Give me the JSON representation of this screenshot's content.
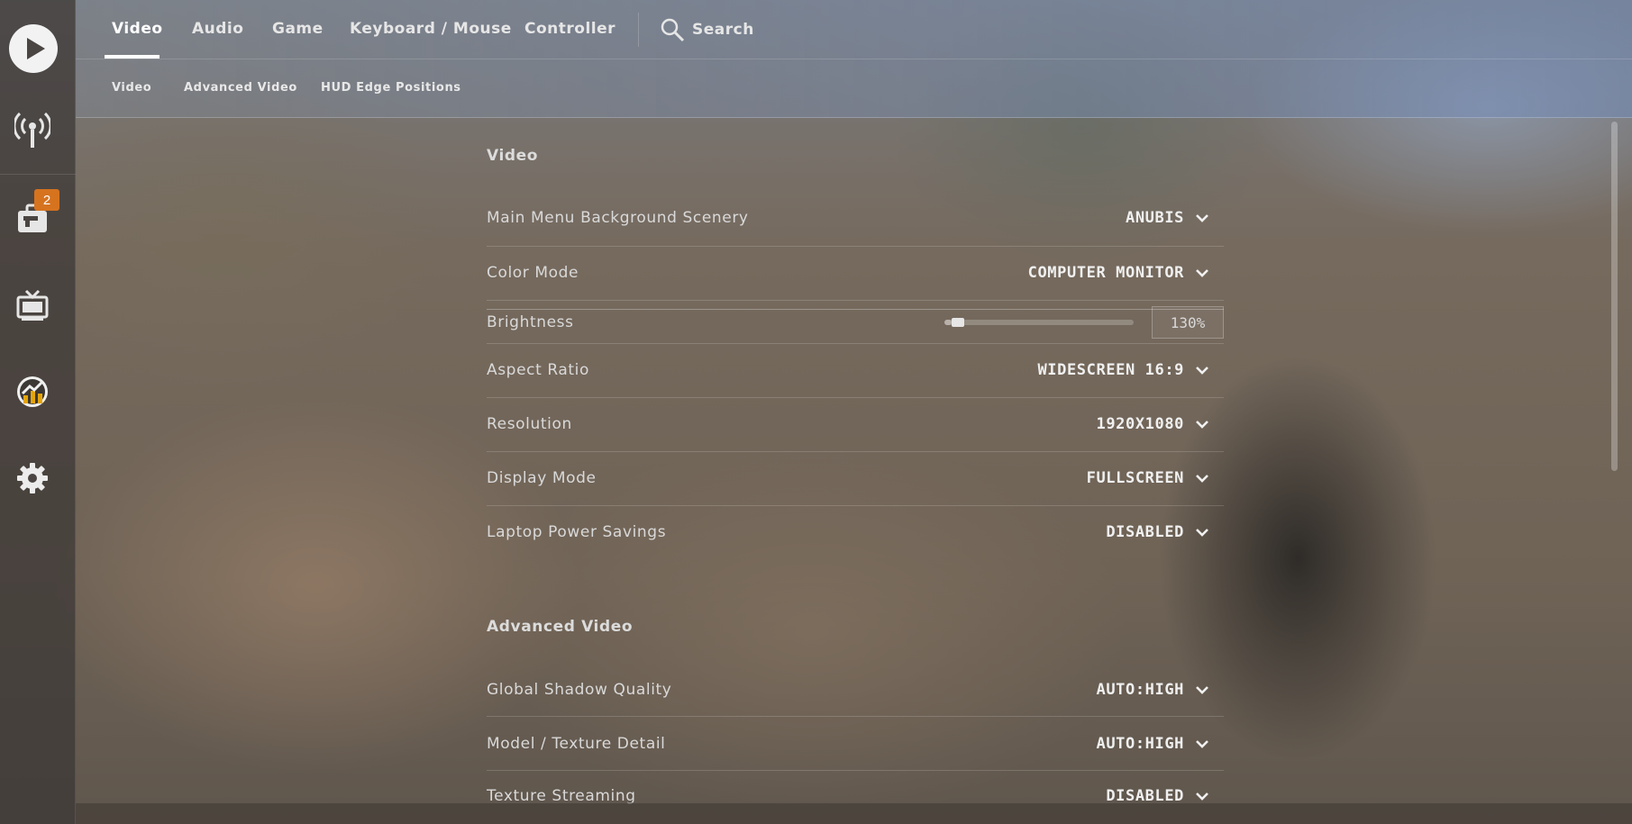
{
  "tabs": [
    {
      "label": "Video",
      "active": true
    },
    {
      "label": "Audio"
    },
    {
      "label": "Game"
    },
    {
      "label": "Keyboard / Mouse"
    },
    {
      "label": "Controller"
    }
  ],
  "search": {
    "label": "Search",
    "icon": "search-icon"
  },
  "subtabs": [
    "Video",
    "Advanced Video",
    "HUD Edge Positions"
  ],
  "sidebar": {
    "items": [
      {
        "icon": "play-icon"
      },
      {
        "icon": "broadcast-icon"
      },
      {
        "icon": "inventory-icon",
        "badge": "2"
      },
      {
        "icon": "tv-icon"
      },
      {
        "icon": "stats-icon"
      },
      {
        "icon": "gear-icon"
      }
    ]
  },
  "sections": [
    {
      "title": "Video",
      "rows": [
        {
          "label": "Main Menu Background Scenery",
          "type": "dropdown",
          "value": "ANUBIS"
        },
        {
          "label": "Color Mode",
          "type": "dropdown",
          "value": "COMPUTER MONITOR"
        },
        {
          "label": "Brightness",
          "type": "slider",
          "value": "130%",
          "fraction": 0.04
        },
        {
          "label": "Aspect Ratio",
          "type": "dropdown",
          "value": "WIDESCREEN 16:9"
        },
        {
          "label": "Resolution",
          "type": "dropdown",
          "value": "1920X1080"
        },
        {
          "label": "Display Mode",
          "type": "dropdown",
          "value": "FULLSCREEN"
        },
        {
          "label": "Laptop Power Savings",
          "type": "dropdown",
          "value": "DISABLED"
        }
      ]
    },
    {
      "title": "Advanced Video",
      "rows": [
        {
          "label": "Global Shadow Quality",
          "type": "dropdown",
          "value": "AUTO:HIGH"
        },
        {
          "label": "Model / Texture Detail",
          "type": "dropdown",
          "value": "AUTO:HIGH"
        },
        {
          "label": "Texture Streaming",
          "type": "dropdown",
          "value": "DISABLED"
        }
      ]
    }
  ],
  "colors": {
    "badge": "#d6731f",
    "accent": "#ffffff"
  }
}
